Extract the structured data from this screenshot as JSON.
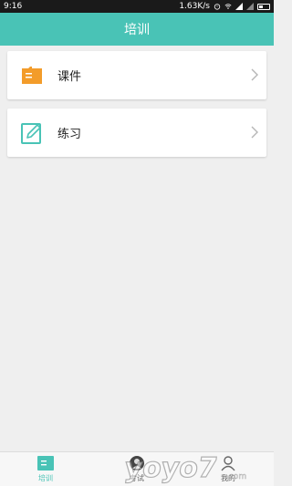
{
  "status_bar": {
    "time": "9:16",
    "network_speed": "1.63K/s",
    "icons": [
      "alarm-icon",
      "wifi-icon",
      "signal-icon",
      "signal-icon",
      "battery-icon"
    ]
  },
  "header": {
    "title": "培训"
  },
  "cards": [
    {
      "label": "课件",
      "icon": "book-icon"
    },
    {
      "label": "练习",
      "icon": "edit-icon"
    }
  ],
  "bottom_nav": {
    "items": [
      {
        "label": "培训",
        "icon": "book-icon",
        "active": true
      },
      {
        "label": "考试",
        "icon": "user-icon",
        "active": false
      },
      {
        "label": "我的",
        "icon": "person-icon",
        "active": false
      }
    ]
  },
  "watermark": {
    "text": "yoyo7.com"
  },
  "colors": {
    "accent": "#49c3b6",
    "orange": "#f39c2a"
  }
}
